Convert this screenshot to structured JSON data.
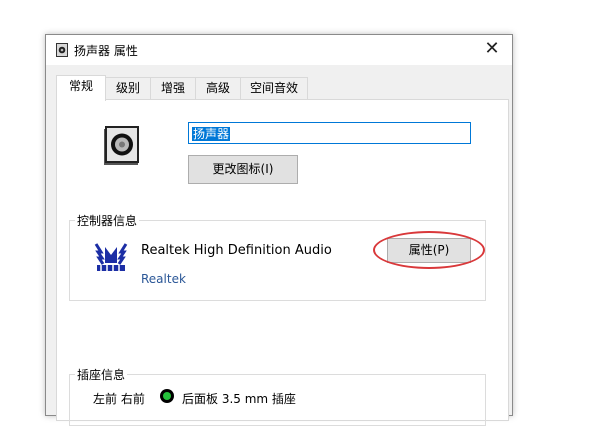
{
  "window": {
    "title": "扬声器 属性",
    "close_glyph": "✕"
  },
  "tabs": [
    {
      "label": "常规",
      "active": true
    },
    {
      "label": "级别",
      "active": false
    },
    {
      "label": "增强",
      "active": false
    },
    {
      "label": "高级",
      "active": false
    },
    {
      "label": "空间音效",
      "active": false
    }
  ],
  "general": {
    "device_name": "扬声器",
    "change_icon_label": "更改图标(I)"
  },
  "controller": {
    "group_label": "控制器信息",
    "name": "Realtek High Definition Audio",
    "vendor": "Realtek",
    "properties_label": "属性(P)"
  },
  "jack": {
    "group_label": "插座信息",
    "channels": "左前 右前",
    "description": "后面板 3.5 mm 插座",
    "color": "#25c13b"
  },
  "annotation": {
    "highlight_color": "#d9383a"
  }
}
